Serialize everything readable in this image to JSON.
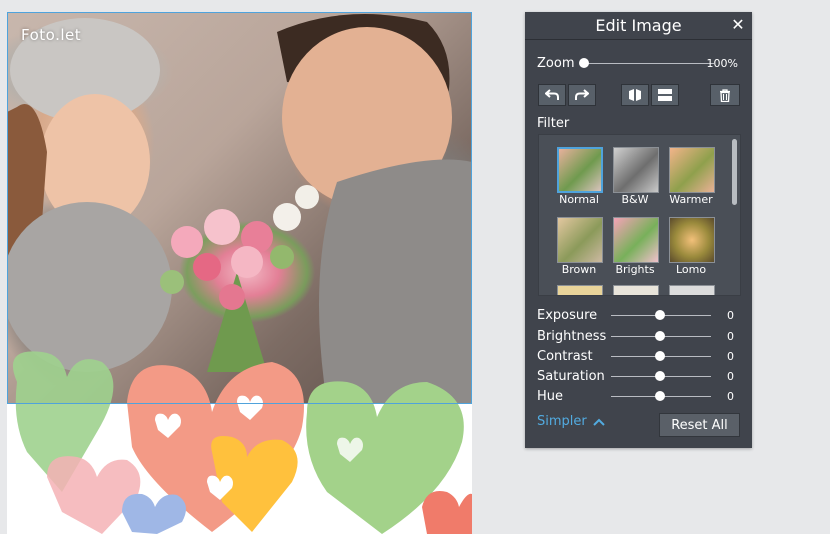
{
  "canvas": {
    "logo": "Foto.let"
  },
  "panel": {
    "title": "Edit Image",
    "zoom": {
      "label": "Zoom",
      "value": "100%",
      "level": 0.0
    },
    "filter": {
      "label": "Filter",
      "items": [
        {
          "label": "Normal",
          "selected": true
        },
        {
          "label": "B&W",
          "selected": false
        },
        {
          "label": "Warmer",
          "selected": false
        },
        {
          "label": "Brown",
          "selected": false
        },
        {
          "label": "Brights",
          "selected": false
        },
        {
          "label": "Lomo",
          "selected": false
        }
      ]
    },
    "adjustments": [
      {
        "label": "Exposure",
        "value": "0"
      },
      {
        "label": "Brightness",
        "value": "0"
      },
      {
        "label": "Contrast",
        "value": "0"
      },
      {
        "label": "Saturation",
        "value": "0"
      },
      {
        "label": "Hue",
        "value": "0"
      }
    ],
    "simpler_label": "Simpler",
    "reset_label": "Reset All"
  },
  "colors": {
    "accent": "#4fa3dc",
    "panel_bg": "#40444c",
    "link": "#52abe0"
  }
}
